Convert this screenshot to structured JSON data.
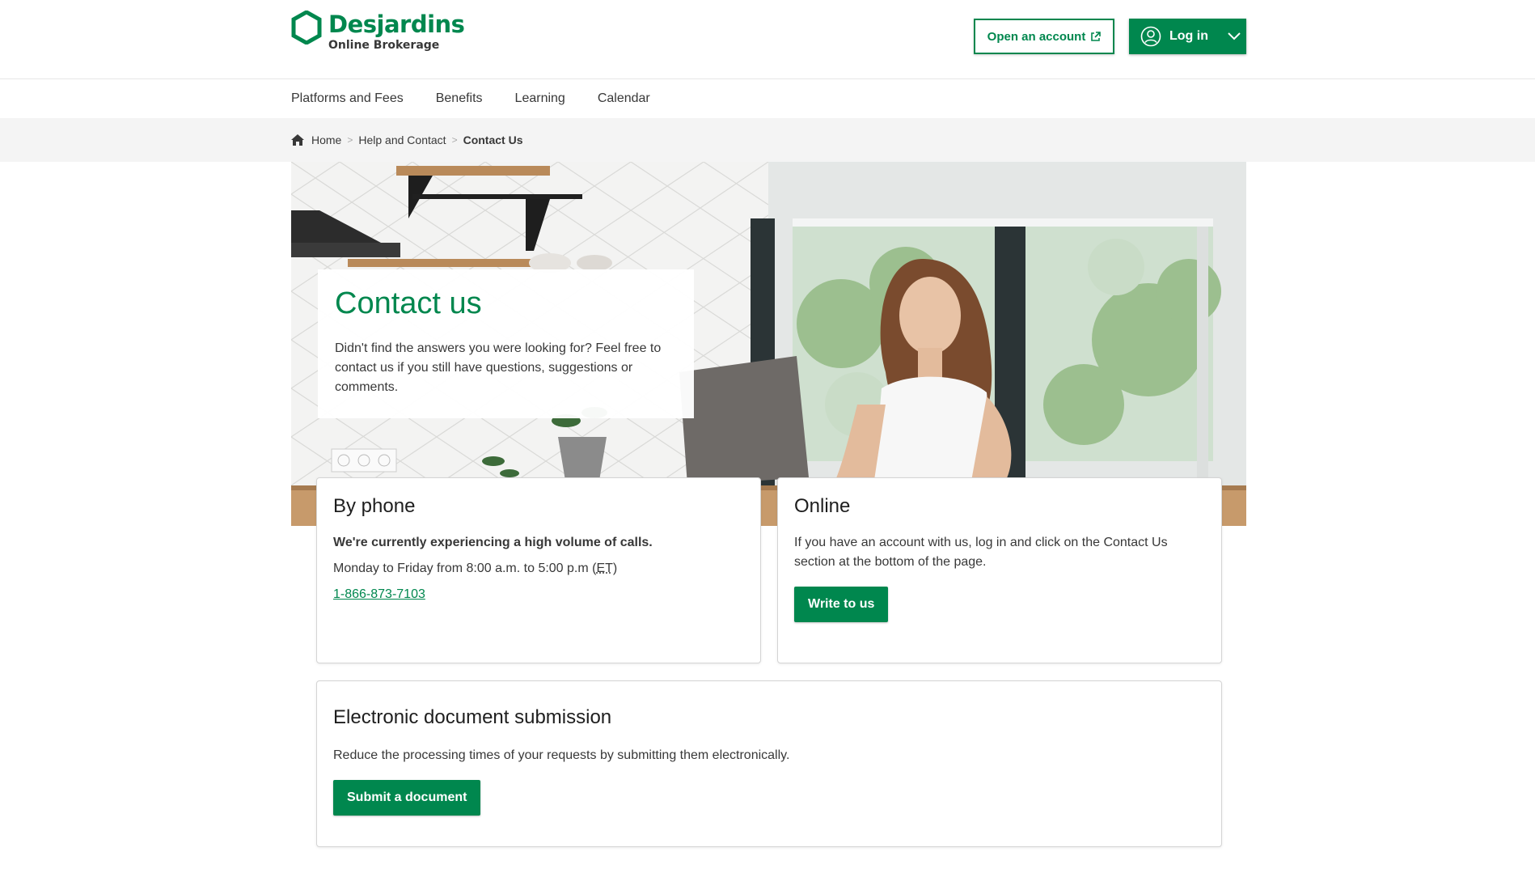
{
  "brand": {
    "name": "Desjardins",
    "subtitle": "Online Brokerage",
    "color": "#00874e"
  },
  "header": {
    "open_account": "Open an account",
    "login": "Log in"
  },
  "nav": {
    "items": [
      "Platforms and Fees",
      "Benefits",
      "Learning",
      "Calendar"
    ]
  },
  "breadcrumb": {
    "home": "Home",
    "help": "Help and Contact",
    "current": "Contact Us"
  },
  "hero": {
    "title": "Contact us",
    "text": "Didn't find the answers you were looking for? Feel free to contact us if you still have questions, suggestions or comments."
  },
  "phone": {
    "title": "By phone",
    "notice": "We're currently experiencing a high volume of calls.",
    "hours_prefix": "Monday to Friday from 8:00 a.m. to 5:00 p.m (",
    "hours_abbr": "ET",
    "hours_suffix": ")",
    "number": "1-866-873-7103"
  },
  "online": {
    "title": "Online",
    "text": "If you have an account with us, log in and click on the Contact Us section at the bottom of the page.",
    "button": "Write to us"
  },
  "documents": {
    "title": "Electronic document submission",
    "text": "Reduce the processing times of your requests by submitting them electronically.",
    "button": "Submit a document"
  }
}
